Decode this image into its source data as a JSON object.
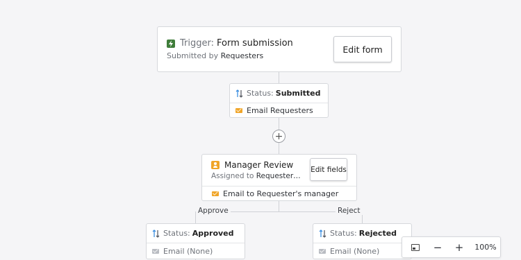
{
  "trigger": {
    "prefix": "Trigger:",
    "name": "Form submission",
    "submitted_by_prefix": "Submitted by",
    "submitted_by": "Requesters",
    "edit_button": "Edit form"
  },
  "step_submitted": {
    "status_prefix": "Status:",
    "status": "Submitted",
    "action": "Email Requesters"
  },
  "add_step": {
    "label": "+"
  },
  "manager_review": {
    "title": "Manager Review",
    "assigned_prefix": "Assigned to",
    "assigned_to": "Requester's m...",
    "edit_button": "Edit fields",
    "action": "Email to Requester's manager"
  },
  "branches": {
    "approve_label": "Approve",
    "reject_label": "Reject"
  },
  "step_approved": {
    "status_prefix": "Status:",
    "status": "Approved",
    "action": "Email (None)"
  },
  "step_rejected": {
    "status_prefix": "Status:",
    "status": "Rejected",
    "action": "Email (None)"
  },
  "zoom_controls": {
    "zoom_out": "−",
    "zoom_in": "+",
    "zoom_level": "100%"
  },
  "colors": {
    "trigger_icon": "#3f7d3a",
    "status_arrow_up": "#3c8ee0",
    "status_arrow_down": "#5a5e66",
    "mail_active": "#f0a528",
    "mail_inactive": "#b9bcc2",
    "user_icon": "#f0a528"
  },
  "icons": [
    "flash-icon",
    "status-arrows-icon",
    "mail-icon",
    "user-icon",
    "add-icon",
    "minimap-icon",
    "zoom-out-icon",
    "zoom-in-icon"
  ]
}
